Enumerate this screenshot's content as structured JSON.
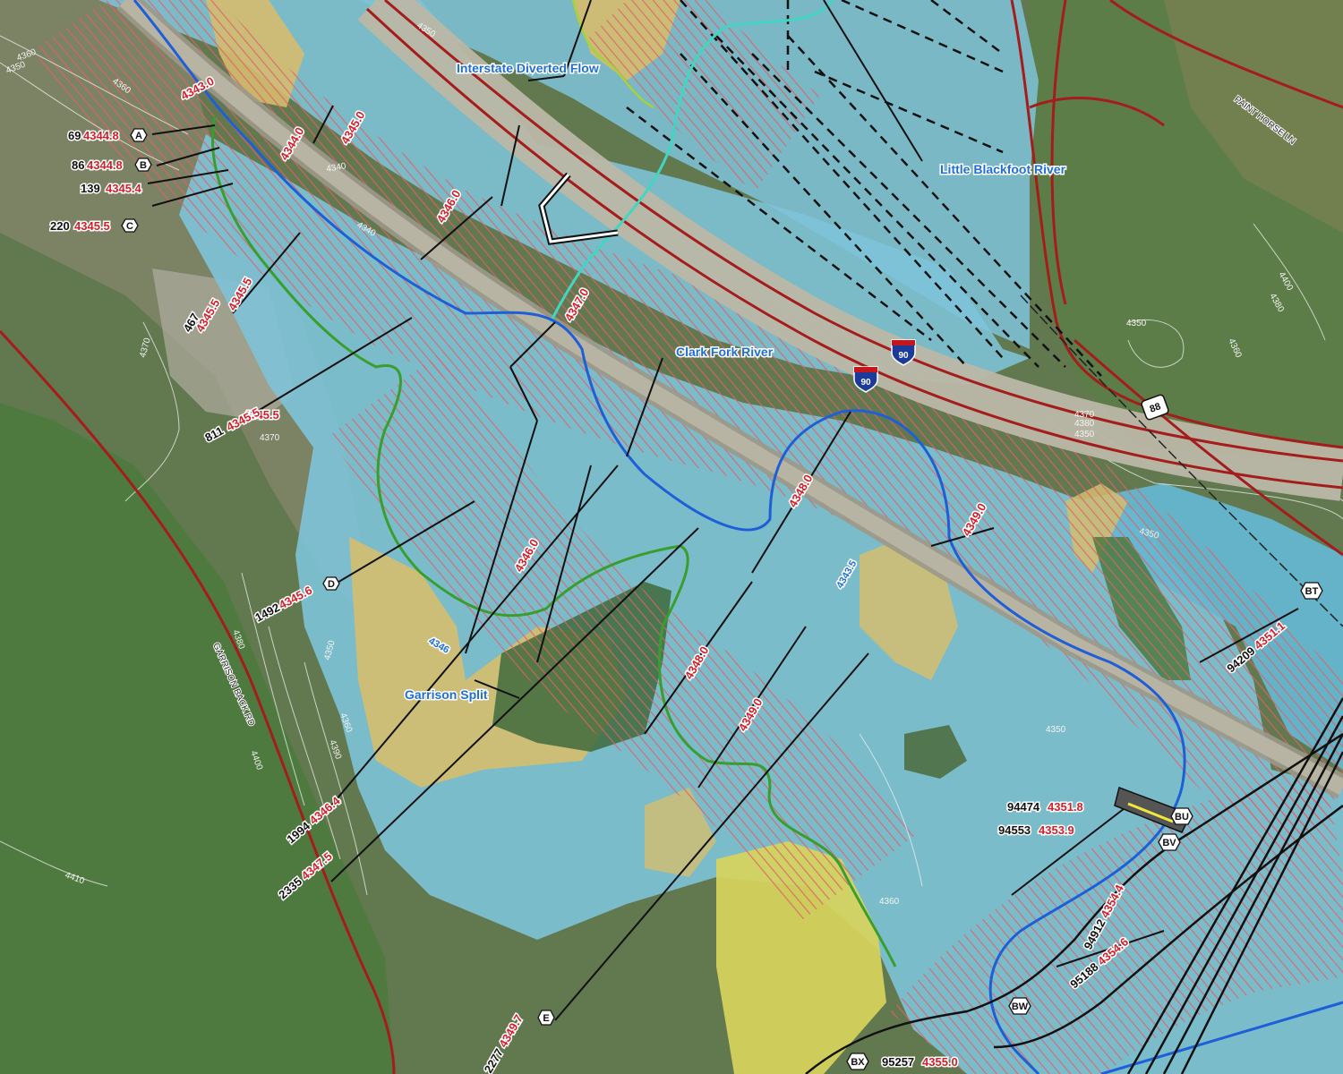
{
  "features": {
    "interstate_diverted_flow": "Interstate Diverted Flow",
    "little_blackfoot": "Little Blackfoot River",
    "clark_fork": "Clark Fork River",
    "garrison_split": "Garrison Split"
  },
  "roads": {
    "paint_horse": "PAINT HORSE LN",
    "garrison_back": "GARRISON BACK RD",
    "i90": "90",
    "us88": "88"
  },
  "contours": [
    "4360",
    "4350",
    "4360",
    "4350",
    "4340",
    "4340",
    "4370",
    "4370",
    "4380",
    "4350",
    "4360",
    "4390",
    "4400",
    "4410",
    "4350",
    "4350",
    "4400",
    "4380",
    "4360",
    "4350",
    "4360",
    "4370",
    "4380",
    "4350"
  ],
  "wse_labels": [
    "4343.0",
    "4344.0",
    "4345.0",
    "4346.0",
    "4345.5",
    "4345.5",
    "4347.0",
    "4346.0",
    "4348.0",
    "4349.0",
    "4348.0",
    "4349.0",
    "4343.5",
    "4346"
  ],
  "cross_sections": [
    {
      "station": "69",
      "wse": "4344.8",
      "id": "A"
    },
    {
      "station": "86",
      "wse": "4344.8",
      "id": "B"
    },
    {
      "station": "139",
      "wse": "4345.4",
      "id": ""
    },
    {
      "station": "220",
      "wse": "4345.5",
      "id": "C"
    },
    {
      "station": "467",
      "wse": "4345.5",
      "id": ""
    },
    {
      "station": "811",
      "wse": "4345.5",
      "id": ""
    },
    {
      "station": "1492",
      "wse": "4345.6",
      "id": "D"
    },
    {
      "station": "1994",
      "wse": "4346.4",
      "id": ""
    },
    {
      "station": "2335",
      "wse": "4347.5",
      "id": ""
    },
    {
      "station": "2277",
      "wse": "4349.7",
      "id": "E"
    },
    {
      "station": "94209",
      "wse": "4351.1",
      "id": "BT"
    },
    {
      "station": "94474",
      "wse": "4351.8",
      "id": "BU"
    },
    {
      "station": "94553",
      "wse": "4353.9",
      "id": "BV"
    },
    {
      "station": "94912",
      "wse": "4354.4",
      "id": ""
    },
    {
      "station": "95188",
      "wse": "4354.6",
      "id": ""
    },
    {
      "station": "95257",
      "wse": "4355.0",
      "id": "BX"
    },
    {
      "station": "",
      "wse": "",
      "id": "BW"
    }
  ],
  "colors": {
    "floodplain": "#7ec3d8",
    "floodway_hatch": "#e0606a",
    "river": "#1e5fd8",
    "channel_green": "#3a9e2e",
    "road_red": "#a41c1c",
    "sand": "#d5bd6e",
    "yellow": "#d7d45c"
  }
}
